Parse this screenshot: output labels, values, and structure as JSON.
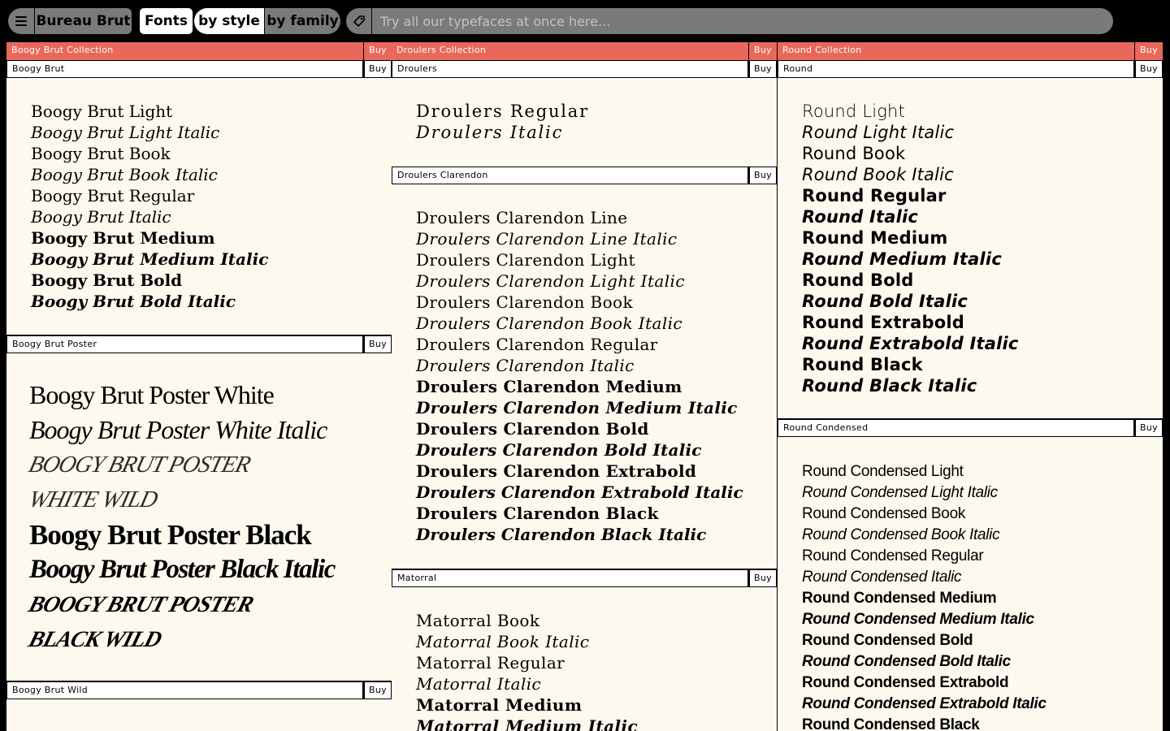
{
  "header": {
    "brand": "Bureau Brut",
    "fonts_label": "Fonts",
    "by_style_label": "by style",
    "by_family_label": "by family",
    "search_placeholder": "Try all our typefaces at once here..."
  },
  "icons": {
    "menu": "hamburger-icon",
    "tag": "price-tag-icon"
  },
  "colors": {
    "collection_bar": "#e8685a",
    "panel_bg": "#fdf9ef",
    "page_bg": "#000000",
    "pill_grey": "#7a7a7a"
  },
  "buy_label": "Buy",
  "columns": [
    {
      "collection": "Boogy Brut Collection",
      "families": [
        {
          "name": "Boogy Brut",
          "styles": [
            "Boogy Brut Light",
            "Boogy Brut Light Italic",
            "Boogy Brut Book",
            "Boogy Brut Book Italic",
            "Boogy Brut Regular",
            "Boogy Brut Italic",
            "Boogy Brut Medium",
            "Boogy Brut Medium Italic",
            "Boogy Brut Bold",
            "Boogy Brut Bold Italic"
          ]
        },
        {
          "name": "Boogy Brut Poster",
          "styles": [
            "Boogy Brut Poster White",
            "Boogy Brut Poster White Italic",
            "BOOGY BRUT POSTER",
            "WHITE WILD",
            "Boogy Brut Poster Black",
            "Boogy Brut Poster Black Italic",
            "BOOGY BRUT POSTER",
            "BLACK WILD"
          ]
        },
        {
          "name": "Boogy Brut Wild",
          "styles": []
        }
      ]
    },
    {
      "collection": "Droulers Collection",
      "families": [
        {
          "name": "Droulers",
          "styles": [
            "Droulers Regular",
            "Droulers Italic"
          ]
        },
        {
          "name": "Droulers Clarendon",
          "styles": [
            "Droulers Clarendon Line",
            "Droulers Clarendon Line Italic",
            "Droulers Clarendon Light",
            "Droulers Clarendon Light Italic",
            "Droulers Clarendon Book",
            "Droulers Clarendon Book Italic",
            "Droulers Clarendon Regular",
            "Droulers Clarendon Italic",
            "Droulers Clarendon Medium",
            "Droulers Clarendon Medium Italic",
            "Droulers Clarendon Bold",
            "Droulers Clarendon Bold Italic",
            "Droulers Clarendon Extrabold",
            "Droulers Clarendon Extrabold Italic",
            "Droulers Clarendon Black",
            "Droulers Clarendon Black Italic"
          ]
        },
        {
          "name": "Matorral",
          "styles": [
            "Matorral Book",
            "Matorral Book Italic",
            "Matorral Regular",
            "Matorral Italic",
            "Matorral Medium",
            "Matorral Medium Italic"
          ]
        }
      ]
    },
    {
      "collection": "Round Collection",
      "families": [
        {
          "name": "Round",
          "styles": [
            "Round Light",
            "Round Light Italic",
            "Round Book",
            "Round Book Italic",
            "Round Regular",
            "Round Italic",
            "Round Medium",
            "Round Medium Italic",
            "Round Bold",
            "Round Bold Italic",
            "Round Extrabold",
            "Round Extrabold Italic",
            "Round Black",
            "Round Black Italic"
          ]
        },
        {
          "name": "Round Condensed",
          "styles": [
            "Round Condensed Light",
            "Round Condensed Light Italic",
            "Round Condensed Book",
            "Round Condensed Book Italic",
            "Round Condensed Regular",
            "Round Condensed Italic",
            "Round Condensed Medium",
            "Round Condensed Medium Italic",
            "Round Condensed Bold",
            "Round Condensed Bold Italic",
            "Round Condensed Extrabold",
            "Round Condensed Extrabold Italic",
            "Round Condensed Black"
          ]
        }
      ]
    }
  ]
}
